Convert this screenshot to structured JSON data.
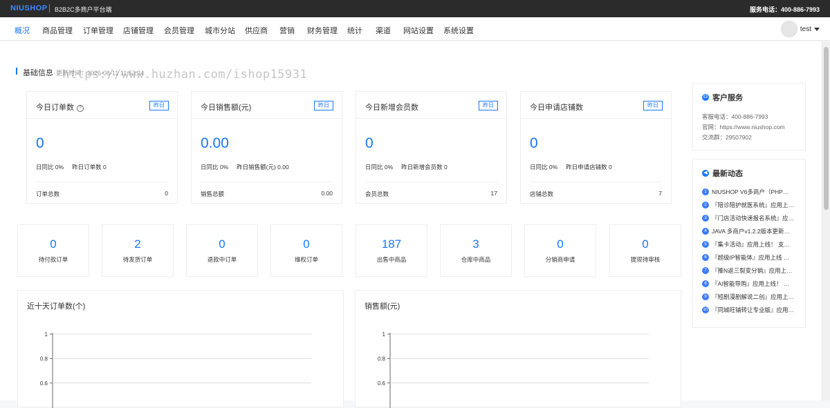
{
  "topbar": {
    "brand": "NIUSHOP",
    "subtitle": "B2B2C多商户平台端",
    "phone": "服务电话：400-886-7993"
  },
  "nav": {
    "items": [
      "概况",
      "商品管理",
      "订单管理",
      "店铺管理",
      "会员管理",
      "城市分站",
      "供应商",
      "营销",
      "财务管理",
      "统计",
      "渠道",
      "网站设置",
      "系统设置"
    ],
    "active": "概况",
    "user": "test"
  },
  "section": {
    "title": "基础信息",
    "update_time": "更新时间：2026-08-11 11:53:24"
  },
  "watermark": "https://www.huzhan.com/ishop15931",
  "cards": [
    {
      "title": "今日订单数",
      "has_help": true,
      "yesterday_btn": "昨日",
      "value": "0",
      "ratio": "日同比 0%",
      "yesterday": "昨日订单数 0",
      "total_label": "订单总数",
      "total_value": "0"
    },
    {
      "title": "今日销售额(元)",
      "has_help": false,
      "yesterday_btn": "昨日",
      "value": "0.00",
      "ratio": "日同比 0%",
      "yesterday": "昨日销售额(元) 0.00",
      "total_label": "销售总额",
      "total_value": "0.00"
    },
    {
      "title": "今日新增会员数",
      "has_help": false,
      "yesterday_btn": "昨日",
      "value": "0",
      "ratio": "日同比 0%",
      "yesterday": "昨日新增会员数 0",
      "total_label": "会员总数",
      "total_value": "17"
    },
    {
      "title": "今日申请店铺数",
      "has_help": false,
      "yesterday_btn": "昨日",
      "value": "0",
      "ratio": "日同比 0%",
      "yesterday": "昨日申请店铺数 0",
      "total_label": "店铺总数",
      "total_value": "7"
    }
  ],
  "stats": [
    {
      "value": "0",
      "label": "待付款订单"
    },
    {
      "value": "2",
      "label": "待发货订单"
    },
    {
      "value": "0",
      "label": "退款中订单"
    },
    {
      "value": "0",
      "label": "维权订单"
    },
    {
      "value": "187",
      "label": "出售中商品"
    },
    {
      "value": "3",
      "label": "仓库中商品"
    },
    {
      "value": "0",
      "label": "分销商申请"
    },
    {
      "value": "0",
      "label": "提现待审核"
    }
  ],
  "charts": [
    {
      "title": "近十天订单数(个)"
    },
    {
      "title": "销售额(元)"
    }
  ],
  "chart_data": [
    {
      "type": "line",
      "title": "近十天订单数(个)",
      "ylim": [
        0,
        1
      ],
      "yticks": [
        "1",
        "0.8",
        "0.6"
      ],
      "series": []
    },
    {
      "type": "line",
      "title": "销售额(元)",
      "ylim": [
        0,
        1
      ],
      "yticks": [
        "1",
        "0.8",
        "0.6"
      ],
      "series": []
    }
  ],
  "service": {
    "title": "客户服务",
    "lines": [
      "客服电话：400-886-7993",
      "官网：https://www.niushop.com",
      "交流群：29507902"
    ]
  },
  "news": {
    "title": "最新动态",
    "items": [
      "NIUSHOP V6多商户（PHP…",
      "『陪诊陪护就医系统』应用上…",
      "『门店活动快速报名系统』应…",
      "JAVA 多商户v1.2.2版本更新…",
      "『集卡活动』应用上线！ 支…",
      "『超级IP智能体』应用上线 …",
      "『推N返三裂变分销』应用上…",
      "『AI智能导购』应用上线！ …",
      "『短剧漫剧解说二创』应用上…",
      "『同城旺铺转让专业版』应用…"
    ]
  },
  "colors": {
    "accent": "#1677ff",
    "topbar": "#2b2b2b"
  }
}
